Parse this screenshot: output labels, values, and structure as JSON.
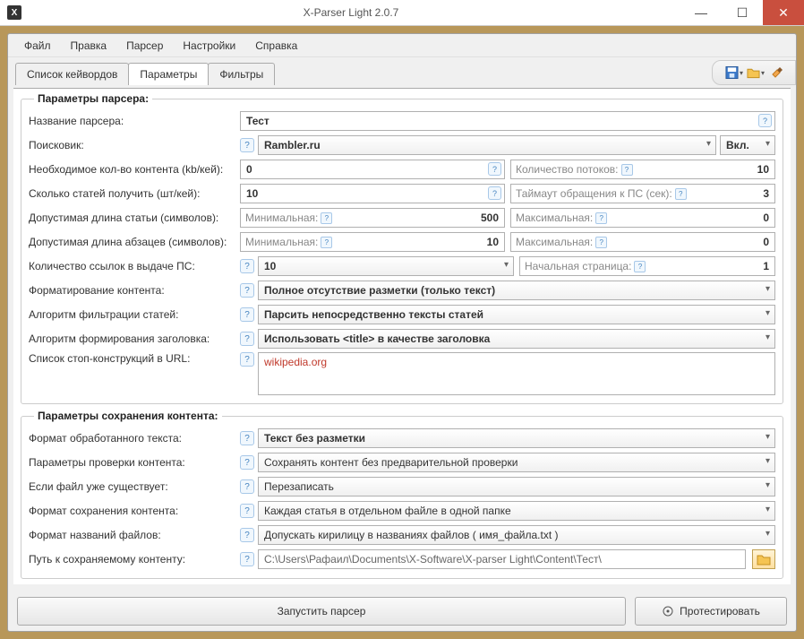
{
  "titlebar": {
    "title": "X-Parser Light 2.0.7"
  },
  "menu": {
    "file": "Файл",
    "edit": "Правка",
    "parser": "Парсер",
    "settings": "Настройки",
    "help": "Справка"
  },
  "tabs": {
    "keywords": "Список кейвордов",
    "params": "Параметры",
    "filters": "Фильтры"
  },
  "parser_section": {
    "legend": "Параметры парсера:",
    "name_label": "Название парсера:",
    "name_value": "Тест",
    "engine_label": "Поисковик:",
    "engine_value": "Rambler.ru",
    "engine_enabled": "Вкл.",
    "content_kb_label": "Необходимое кол-во контента (kb/кей):",
    "content_kb_value": "0",
    "threads_label": "Количество потоков:",
    "threads_value": "10",
    "articles_label": "Сколько статей получить (шт/кей):",
    "articles_value": "10",
    "timeout_label": "Таймаут обращения к ПС (сек):",
    "timeout_value": "3",
    "art_len_label": "Допустимая длина статьи (символов):",
    "art_len_min_ph": "Минимальная:",
    "art_len_min": "500",
    "art_len_max_ph": "Максимальная:",
    "art_len_max": "0",
    "para_len_label": "Допустимая длина абзацев (символов):",
    "para_len_min": "10",
    "para_len_max": "0",
    "links_label": "Количество ссылок в выдаче ПС:",
    "links_value": "10",
    "start_page_label": "Начальная страница:",
    "start_page_value": "1",
    "format_label": "Форматирование контента:",
    "format_value": "Полное отсутствие разметки (только текст)",
    "filter_algo_label": "Алгоритм фильтрации статей:",
    "filter_algo_value": "Парсить непосредственно тексты статей",
    "title_algo_label": "Алгоритм формирования заголовка:",
    "title_algo_value": "Использовать <title> в качестве заголовка",
    "stop_label": "Список стоп-конструкций в URL:",
    "stop_value": "wikipedia.org"
  },
  "save_section": {
    "legend": "Параметры сохранения контента:",
    "text_format_label": "Формат обработанного текста:",
    "text_format_value": "Текст без разметки",
    "check_label": "Параметры проверки контента:",
    "check_value": "Сохранять контент без предварительной проверки",
    "exists_label": "Если файл уже существует:",
    "exists_value": "Перезаписать",
    "save_format_label": "Формат сохранения контента:",
    "save_format_value": "Каждая статья в отдельном файле в одной папке",
    "filename_label": "Формат названий файлов:",
    "filename_value": "Допускать кирилицу в названиях файлов ( имя_файла.txt )",
    "path_label": "Путь к сохраняемому контенту:",
    "path_value": "C:\\Users\\Рафаил\\Documents\\X-Software\\X-parser Light\\Content\\Тест\\"
  },
  "buttons": {
    "run": "Запустить парсер",
    "test": "Протестировать"
  }
}
